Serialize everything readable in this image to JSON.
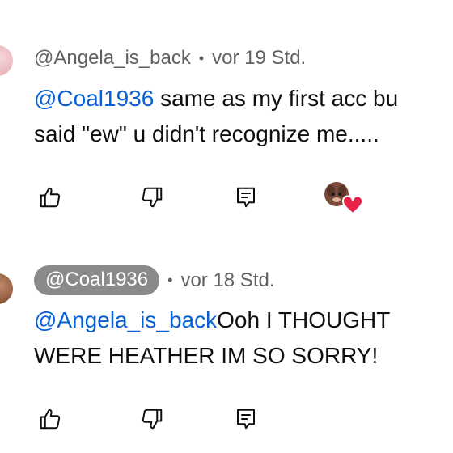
{
  "comments": [
    {
      "author": "@Angela_is_back",
      "separator": "•",
      "time": "vor 19 Std.",
      "mention": "@Coal1936",
      "text_line1": " same as my first acc bu",
      "text_line2": "said \"ew\" u didn't recognize me.....",
      "creator_heart": true
    },
    {
      "author": "@Coal1936",
      "separator": "•",
      "time": "vor 18 Std.",
      "mention": "@Angela_is_back",
      "text_line1": "Ooh I THOUGHT",
      "text_line2": "WERE HEATHER IM SO SORRY!",
      "creator_heart": false
    }
  ],
  "icons": {
    "like": "thumbs-up-icon",
    "dislike": "thumbs-down-icon",
    "reply": "reply-icon",
    "heart": "creator-heart-icon"
  },
  "colors": {
    "mention": "#065fd4",
    "meta": "#606060",
    "pill_bg": "#8a8a8a",
    "heart": "#e8234a"
  }
}
